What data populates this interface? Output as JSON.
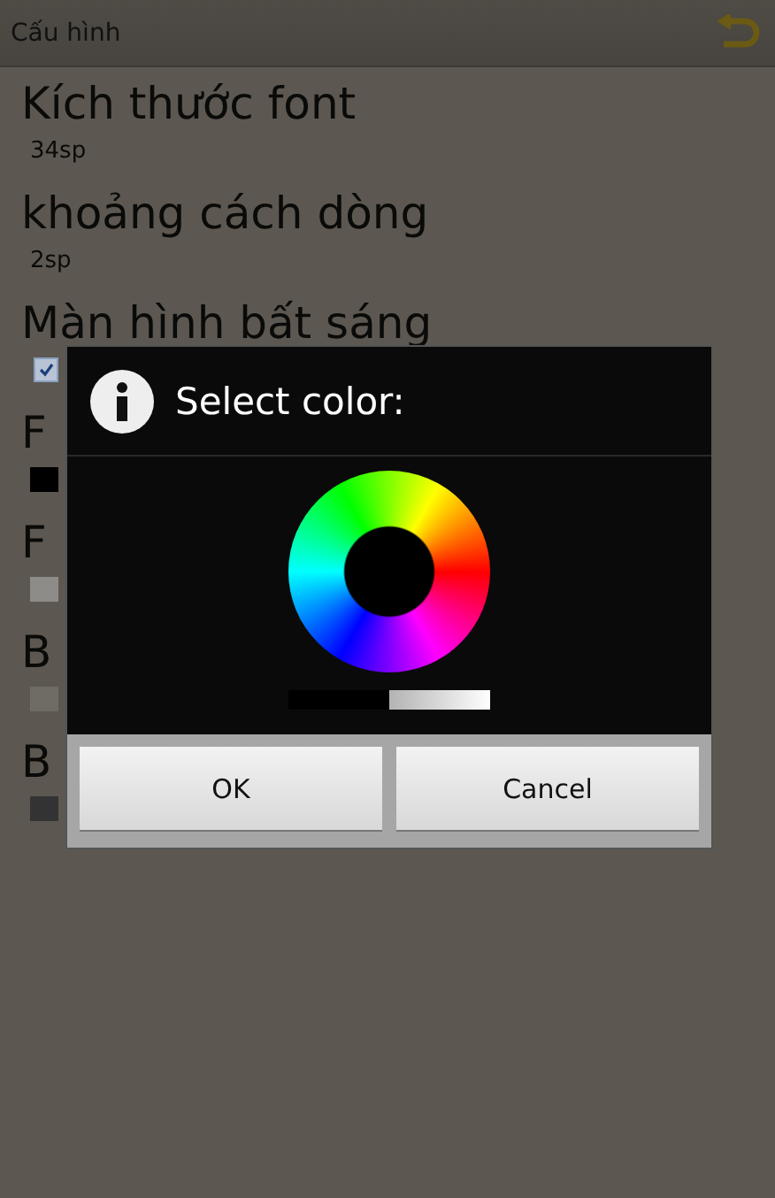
{
  "action_bar": {
    "title": "Cấu hình"
  },
  "settings": [
    {
      "title": "Kích thước font",
      "kind": "value",
      "value": "34sp"
    },
    {
      "title": "khoảng cách dòng",
      "kind": "value",
      "value": "2sp"
    },
    {
      "title": "Màn hình bất sáng",
      "kind": "checkbox",
      "checked": true
    },
    {
      "title": "F",
      "kind": "swatch",
      "color": "#000000"
    },
    {
      "title": "F",
      "kind": "swatch",
      "color": "#8e8c88"
    },
    {
      "title": "B",
      "kind": "swatch",
      "color": "#6f6c65"
    },
    {
      "title": "B",
      "kind": "swatch",
      "color": "#333333"
    }
  ],
  "dialog": {
    "title": "Select color:",
    "brightness": {
      "level": 0.5
    },
    "buttons": [
      "OK",
      "Cancel"
    ]
  }
}
